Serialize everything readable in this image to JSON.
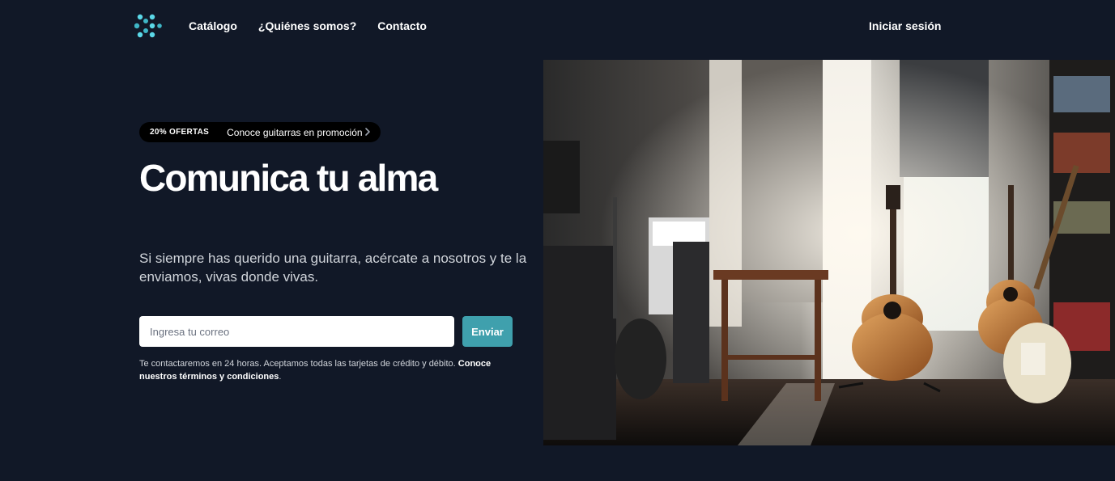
{
  "header": {
    "logo_icon": "dots-logo-icon",
    "nav": [
      {
        "label": "Catálogo"
      },
      {
        "label": "¿Quiénes somos?"
      },
      {
        "label": "Contacto"
      }
    ],
    "login_label": "Iniciar sesión"
  },
  "hero": {
    "promo_badge": "20% OFERTAS",
    "promo_text": "Conoce guitarras en promoción",
    "promo_icon": "chevron-right-icon",
    "title": "Comunica tu alma",
    "description": "Si siempre has querido una guitarra, acércate a nosotros y te la enviamos, vivas donde vivas.",
    "email_placeholder": "Ingresa tu correo",
    "email_value": "",
    "submit_label": "Enviar",
    "fine_print": "Te contactaremos en 24 horas. Aceptamos todas las tarjetas de crédito y débito.",
    "terms_link": "Conoce nuestros términos y condiciones",
    "fine_print_end": "."
  },
  "image": {
    "icon": "guitar-room-photo",
    "description": ""
  },
  "colors": {
    "background": "#111827",
    "accent": "#3fa0ad",
    "logo": "#5bd8e8",
    "pill": "#000000"
  }
}
